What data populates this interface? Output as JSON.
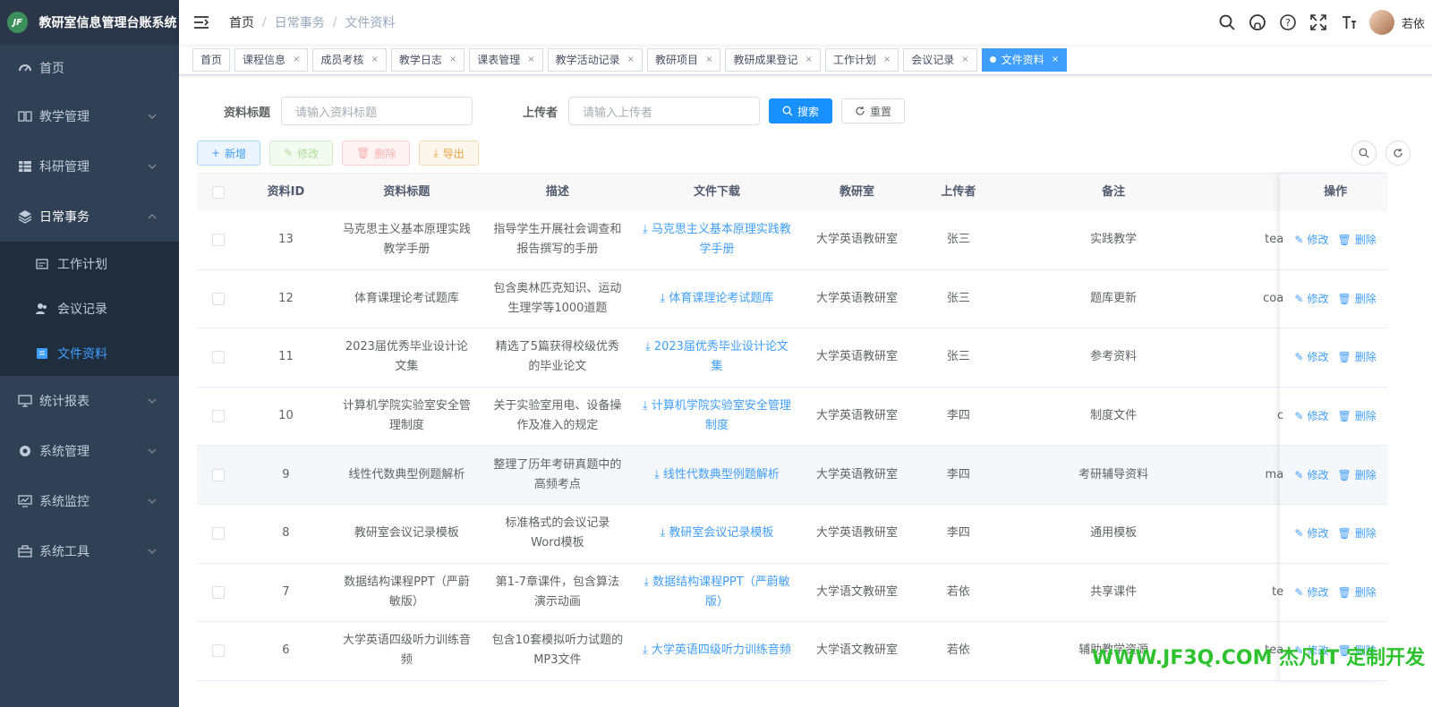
{
  "app": {
    "title": "教研室信息管理台账系统",
    "logo_text": "JF",
    "brand_color": "#409eff"
  },
  "sidebar": {
    "items": [
      {
        "label": "首页",
        "icon": "dashboard-icon"
      },
      {
        "label": "教学管理",
        "icon": "book-icon"
      },
      {
        "label": "科研管理",
        "icon": "table-icon"
      },
      {
        "label": "日常事务",
        "icon": "layers-icon",
        "expanded": true,
        "children": [
          {
            "label": "工作计划",
            "icon": "plan-icon"
          },
          {
            "label": "会议记录",
            "icon": "people-icon"
          },
          {
            "label": "文件资料",
            "icon": "file-icon",
            "active": true
          }
        ]
      },
      {
        "label": "统计报表",
        "icon": "monitor-icon"
      },
      {
        "label": "系统管理",
        "icon": "settings-icon"
      },
      {
        "label": "系统监控",
        "icon": "chart-monitor-icon"
      },
      {
        "label": "系统工具",
        "icon": "toolbox-icon"
      }
    ]
  },
  "navbar": {
    "breadcrumb": [
      "首页",
      "日常事务",
      "文件资料"
    ],
    "username": "若依",
    "icons": [
      "search-icon",
      "github-icon",
      "question-icon",
      "fullscreen-icon",
      "font-size-icon"
    ]
  },
  "tags": [
    {
      "label": "首页",
      "closable": false
    },
    {
      "label": "课程信息",
      "closable": true
    },
    {
      "label": "成员考核",
      "closable": true
    },
    {
      "label": "教学日志",
      "closable": true
    },
    {
      "label": "课表管理",
      "closable": true
    },
    {
      "label": "教学活动记录",
      "closable": true
    },
    {
      "label": "教研项目",
      "closable": true
    },
    {
      "label": "教研成果登记",
      "closable": true
    },
    {
      "label": "工作计划",
      "closable": true
    },
    {
      "label": "会议记录",
      "closable": true
    },
    {
      "label": "文件资料",
      "closable": true,
      "active": true
    }
  ],
  "search": {
    "title_label": "资料标题",
    "title_placeholder": "请输入资料标题",
    "uploader_label": "上传者",
    "uploader_placeholder": "请输入上传者",
    "search_btn": "搜索",
    "reset_btn": "重置"
  },
  "toolbar": {
    "add": "新增",
    "edit": "修改",
    "delete": "删除",
    "export": "导出"
  },
  "table": {
    "columns": [
      "资料ID",
      "资料标题",
      "描述",
      "文件下载",
      "教研室",
      "上传者",
      "备注",
      "操作"
    ],
    "op_edit": "修改",
    "op_delete": "删除",
    "rows": [
      {
        "id": "13",
        "title": "马克思主义基本原理实践教学手册",
        "desc": "指导学生开展社会调查和报告撰写的手册",
        "file": "马克思主义基本原理实践教学手册",
        "dept": "大学英语教研室",
        "uploader": "张三",
        "remark": "实践教学",
        "extra": "tea"
      },
      {
        "id": "12",
        "title": "体育课理论考试题库",
        "desc": "包含奥林匹克知识、运动生理学等1000道题",
        "file": "体育课理论考试题库",
        "dept": "大学英语教研室",
        "uploader": "张三",
        "remark": "题库更新",
        "extra": "coa"
      },
      {
        "id": "11",
        "title": "2023届优秀毕业设计论文集",
        "desc": "精选了5篇获得校级优秀的毕业论文",
        "file": "2023届优秀毕业设计论文集",
        "dept": "大学英语教研室",
        "uploader": "张三",
        "remark": "参考资料",
        "extra": ""
      },
      {
        "id": "10",
        "title": "计算机学院实验室安全管理制度",
        "desc": "关于实验室用电、设备操作及准入的规定",
        "file": "计算机学院实验室安全管理制度",
        "dept": "大学英语教研室",
        "uploader": "李四",
        "remark": "制度文件",
        "extra": "c"
      },
      {
        "id": "9",
        "title": "线性代数典型例题解析",
        "desc": "整理了历年考研真题中的高频考点",
        "file": "线性代数典型例题解析",
        "dept": "大学英语教研室",
        "uploader": "李四",
        "remark": "考研辅导资料",
        "extra": "ma"
      },
      {
        "id": "8",
        "title": "教研室会议记录模板",
        "desc": "标准格式的会议记录Word模板",
        "file": "教研室会议记录模板",
        "dept": "大学英语教研室",
        "uploader": "李四",
        "remark": "通用模板",
        "extra": ""
      },
      {
        "id": "7",
        "title": "数据结构课程PPT（严蔚敏版）",
        "desc": "第1-7章课件，包含算法演示动画",
        "file": "数据结构课程PPT（严蔚敏版）",
        "dept": "大学语文教研室",
        "uploader": "若依",
        "remark": "共享课件",
        "extra": "te"
      },
      {
        "id": "6",
        "title": "大学英语四级听力训练音频",
        "desc": "包含10套模拟听力试题的MP3文件",
        "file": "大学英语四级听力训练音频",
        "dept": "大学语文教研室",
        "uploader": "若依",
        "remark": "辅助教学资源",
        "extra": "tea"
      }
    ]
  },
  "watermark": "WWW.JF3Q.COM 杰凡IT  定制开发"
}
